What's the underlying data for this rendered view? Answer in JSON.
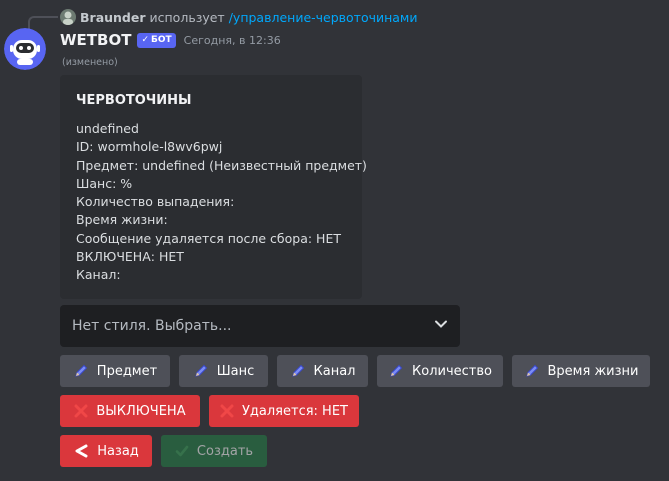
{
  "reply": {
    "username": "Braunder",
    "uses": "использует",
    "command": "/управление-червоточинами"
  },
  "message": {
    "bot_name": "WETBOT",
    "badge": "БОТ",
    "timestamp": "Сегодня, в 12:36",
    "edited": "(изменено)"
  },
  "embed": {
    "title": "ЧЕРВОТОЧИНЫ",
    "lines": [
      "undefined",
      "ID: wormhole-l8wv6pwj",
      "Предмет: undefined (Неизвестный предмет)",
      "Шанс: %",
      "Количество выпадения:",
      "Время жизни:",
      "Сообщение удаляется после сбора: НЕТ",
      "ВКЛЮЧЕНА: НЕТ",
      "Канал:"
    ]
  },
  "select": {
    "placeholder": "Нет стиля. Выбрать..."
  },
  "buttons": {
    "row1": [
      "Предмет",
      "Шанс",
      "Канал",
      "Количество",
      "Время жизни"
    ],
    "toggle": "ВЫКЛЮЧЕНА",
    "delete": "Удаляется: НЕТ",
    "back": "Назад",
    "create": "Создать"
  },
  "colors": {
    "background": "#313338",
    "embed": "#2b2d31",
    "blurple": "#5865f2",
    "danger": "#da373c",
    "success": "#248046",
    "secondary": "#4e5058"
  }
}
